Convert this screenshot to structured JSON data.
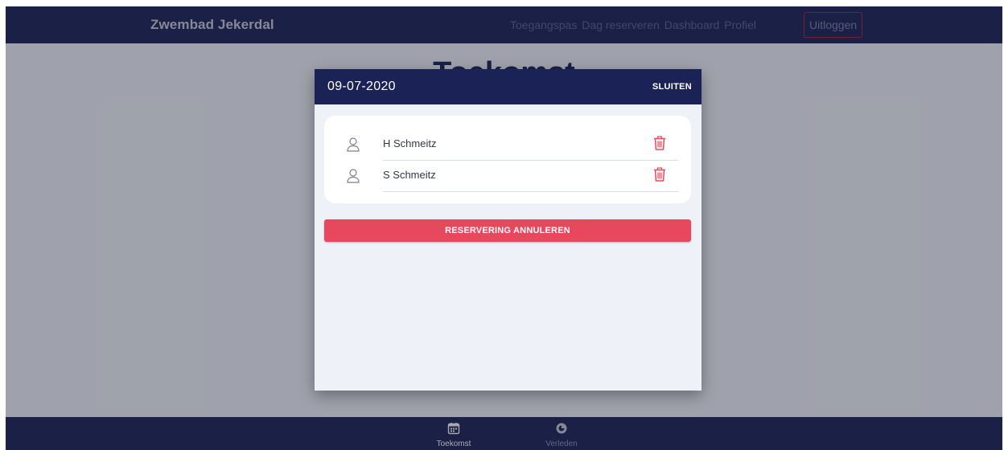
{
  "navbar": {
    "brand": "Zwembad Jekerdal",
    "links": [
      {
        "label": "Toegangspas"
      },
      {
        "label": "Dag reserveren"
      },
      {
        "label": "Dashboard"
      },
      {
        "label": "Profiel"
      }
    ],
    "logout_label": "Uitloggen"
  },
  "page": {
    "title": "Toekomst"
  },
  "modal": {
    "date": "09-07-2020",
    "close_label": "SLUITEN",
    "persons": [
      {
        "name": "H Schmeitz",
        "icon": "user-icon",
        "action_icon": "trash-icon"
      },
      {
        "name": "S Schmeitz",
        "icon": "user-icon",
        "action_icon": "trash-icon"
      }
    ],
    "cancel_label": "RESERVERING ANNULEREN"
  },
  "bottom_nav": {
    "tabs": [
      {
        "label": "Toekomst",
        "icon": "calendar-icon"
      },
      {
        "label": "Verleden",
        "icon": "history-icon"
      }
    ]
  },
  "colors": {
    "navy": "#1b2356",
    "accent_red": "#e8485d",
    "modal_bg": "#eef2f8"
  }
}
